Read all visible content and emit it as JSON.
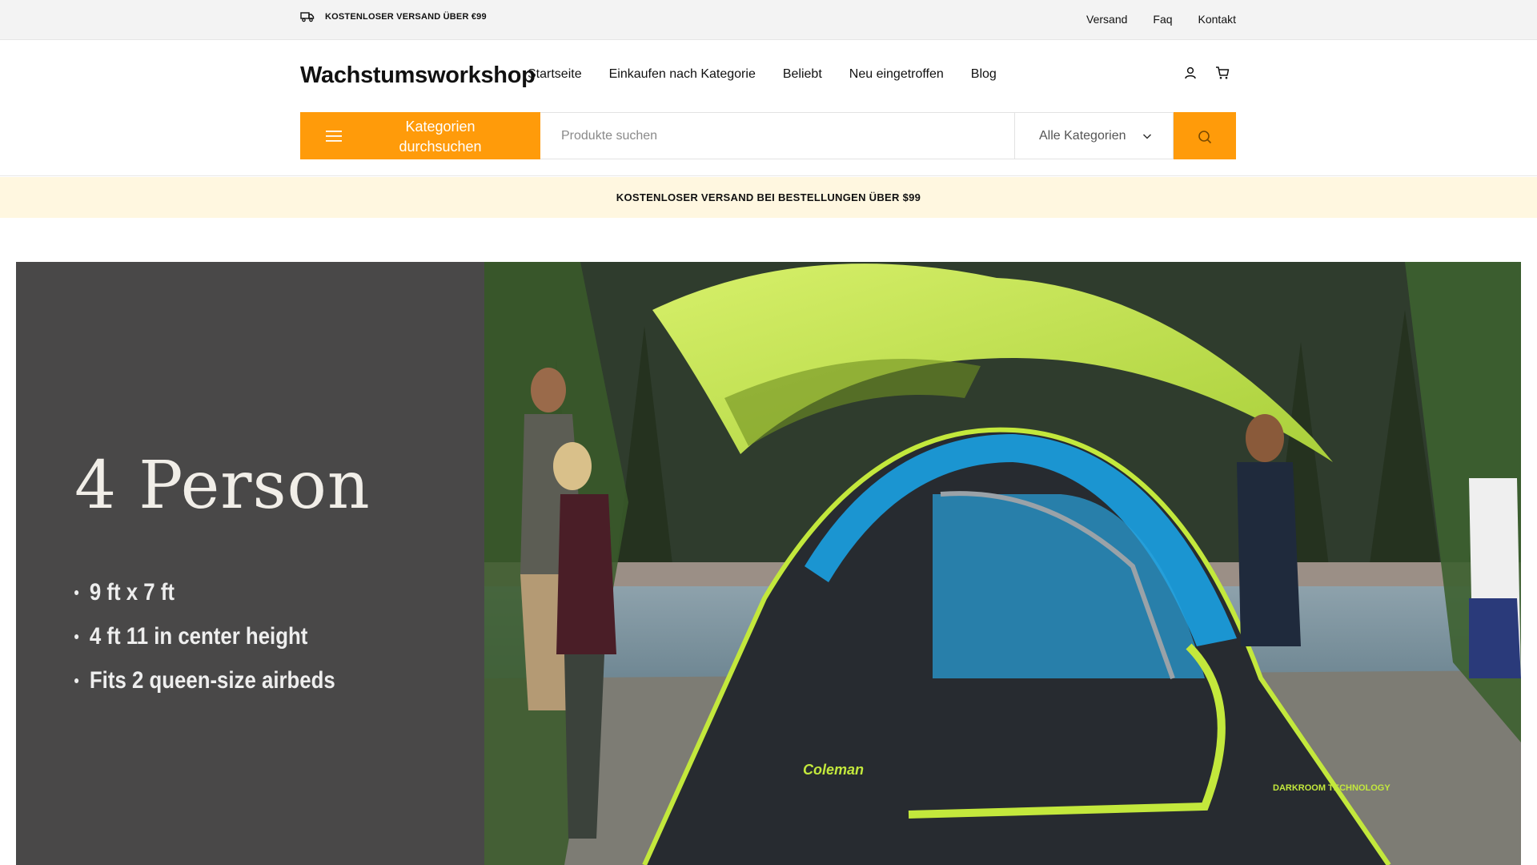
{
  "topbar": {
    "promo_text": "KOSTENLOSER VERSAND ÜBER €99",
    "links": [
      "Versand",
      "Faq",
      "Kontakt"
    ]
  },
  "header": {
    "logo": "Wachstumsworkshop",
    "nav": [
      "Startseite",
      "Einkaufen nach Kategorie",
      "Beliebt",
      "Neu eingetroffen",
      "Blog"
    ],
    "category_button": "Kategorien durchsuchen",
    "search_placeholder": "Produkte suchen",
    "category_select": "Alle Kategorien",
    "icons": [
      "user-icon",
      "cart-icon",
      "search-icon",
      "menu-icon",
      "truck-icon"
    ]
  },
  "notice": {
    "text": "KOSTENLOSER VERSAND BEI BESTELLUNGEN ÜBER $99"
  },
  "hero": {
    "title": "4 Person",
    "specs": [
      "9 ft x 7 ft",
      "4 ft 11 in center height",
      "Fits 2 queen-size airbeds"
    ],
    "tent_brand": "Coleman",
    "tent_brand_sub": "DARKROOM TECHNOLOGY"
  },
  "colors": {
    "accent": "#ff9b0a",
    "hero_panel": "#494848",
    "notice_bg": "#fff7e0"
  }
}
